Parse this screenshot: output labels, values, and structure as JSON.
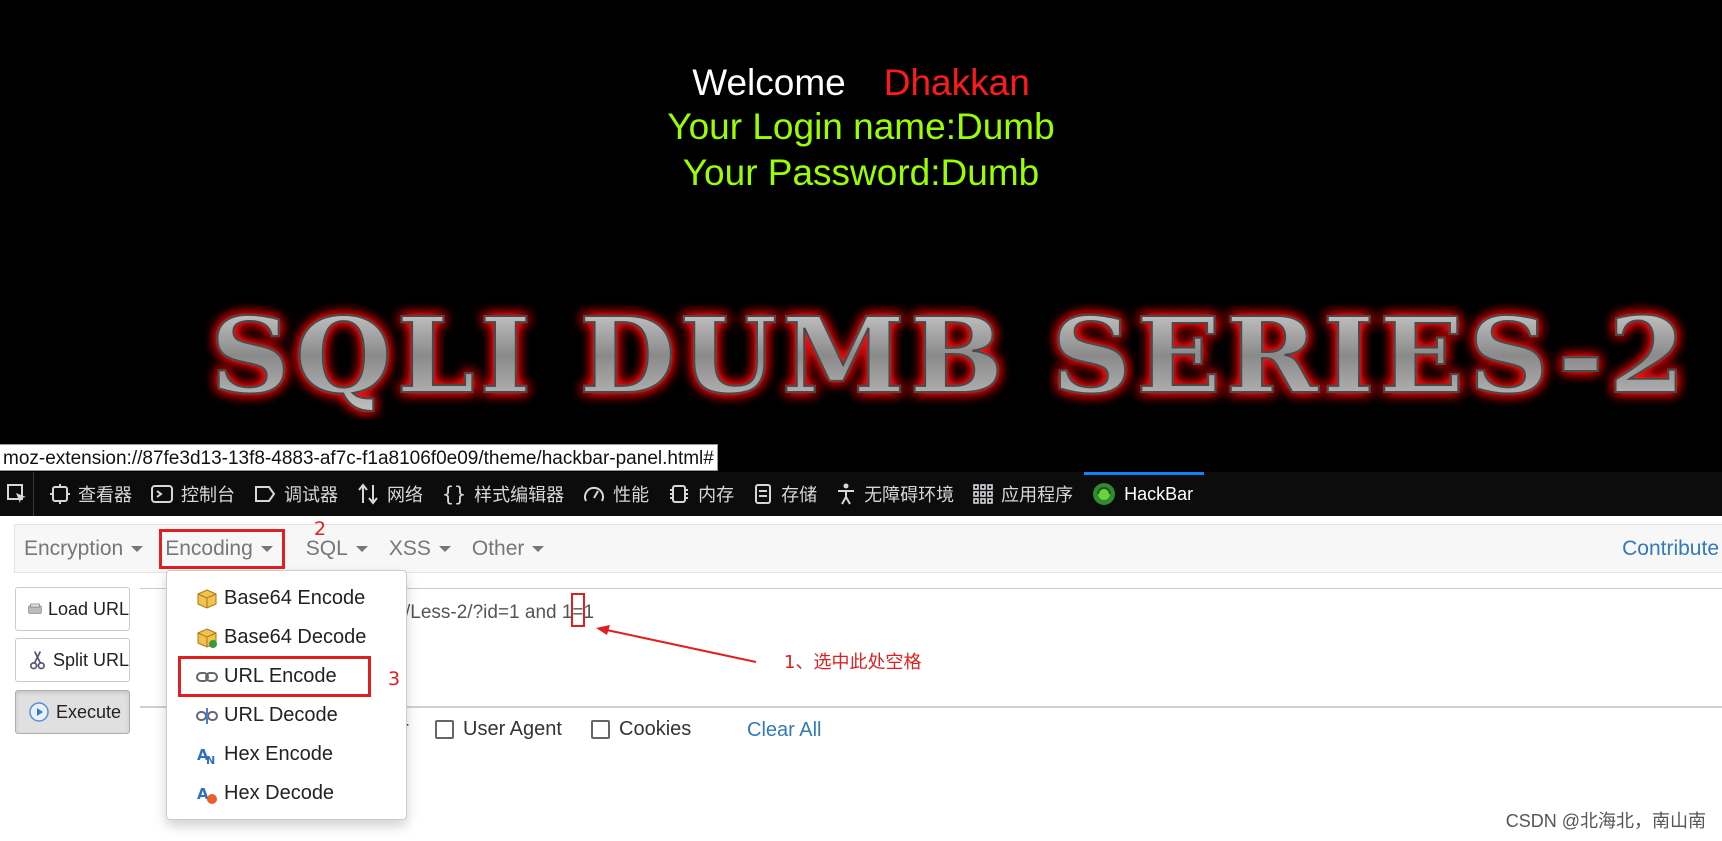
{
  "page": {
    "welcome_label": "Welcome",
    "welcome_name": "Dhakkan",
    "login_line": "Your Login name:Dumb",
    "password_line": "Your Password:Dumb",
    "banner_text": "SQLI DUMB SERIES-2",
    "status_url": "moz-extension://87fe3d13-13f8-4883-af7c-f1a8106f0e09/theme/hackbar-panel.html#"
  },
  "devtools": {
    "tabs": [
      {
        "label": "查看器",
        "icon": "inspector-icon"
      },
      {
        "label": "控制台",
        "icon": "console-icon"
      },
      {
        "label": "调试器",
        "icon": "debugger-icon"
      },
      {
        "label": "网络",
        "icon": "network-icon"
      },
      {
        "label": "样式编辑器",
        "icon": "style-editor-icon"
      },
      {
        "label": "性能",
        "icon": "performance-icon"
      },
      {
        "label": "内存",
        "icon": "memory-icon"
      },
      {
        "label": "存储",
        "icon": "storage-icon"
      },
      {
        "label": "无障碍环境",
        "icon": "accessibility-icon"
      },
      {
        "label": "应用程序",
        "icon": "application-icon"
      },
      {
        "label": "HackBar",
        "icon": "hackbar-icon",
        "active": true
      }
    ]
  },
  "hackbar": {
    "menu": {
      "encryption": "Encryption",
      "encoding": "Encoding",
      "sql": "SQL",
      "xss": "XSS",
      "other": "Other",
      "contribute": "Contribute"
    },
    "buttons": {
      "load_url": "Load URL",
      "split_url": "Split URL",
      "execute": "Execute"
    },
    "url_value": "/Less-2/?id=1 and 1=1",
    "options": {
      "referrer_fragment": "r",
      "user_agent": "User Agent",
      "cookies": "Cookies",
      "clear_all": "Clear All"
    },
    "encoding_menu": [
      {
        "label": "Base64 Encode",
        "icon": "base64-encode-icon"
      },
      {
        "label": "Base64 Decode",
        "icon": "base64-decode-icon"
      },
      {
        "label": "URL Encode",
        "icon": "url-encode-icon"
      },
      {
        "label": "URL Decode",
        "icon": "url-decode-icon"
      },
      {
        "label": "Hex Encode",
        "icon": "hex-encode-icon"
      },
      {
        "label": "Hex Decode",
        "icon": "hex-decode-icon"
      }
    ]
  },
  "annotations": {
    "step1": "1、选中此处空格",
    "step2": "2",
    "step3": "3"
  },
  "watermark": "CSDN @北海北，南山南",
  "colors": {
    "page_bg": "#000000",
    "welcome_name": "#ff1a1a",
    "login_text": "#99ff00",
    "annotation_red": "#e02020",
    "link_blue": "#337ab7",
    "devtools_bg": "#0c0c0d",
    "devtools_active": "#0a84ff"
  }
}
